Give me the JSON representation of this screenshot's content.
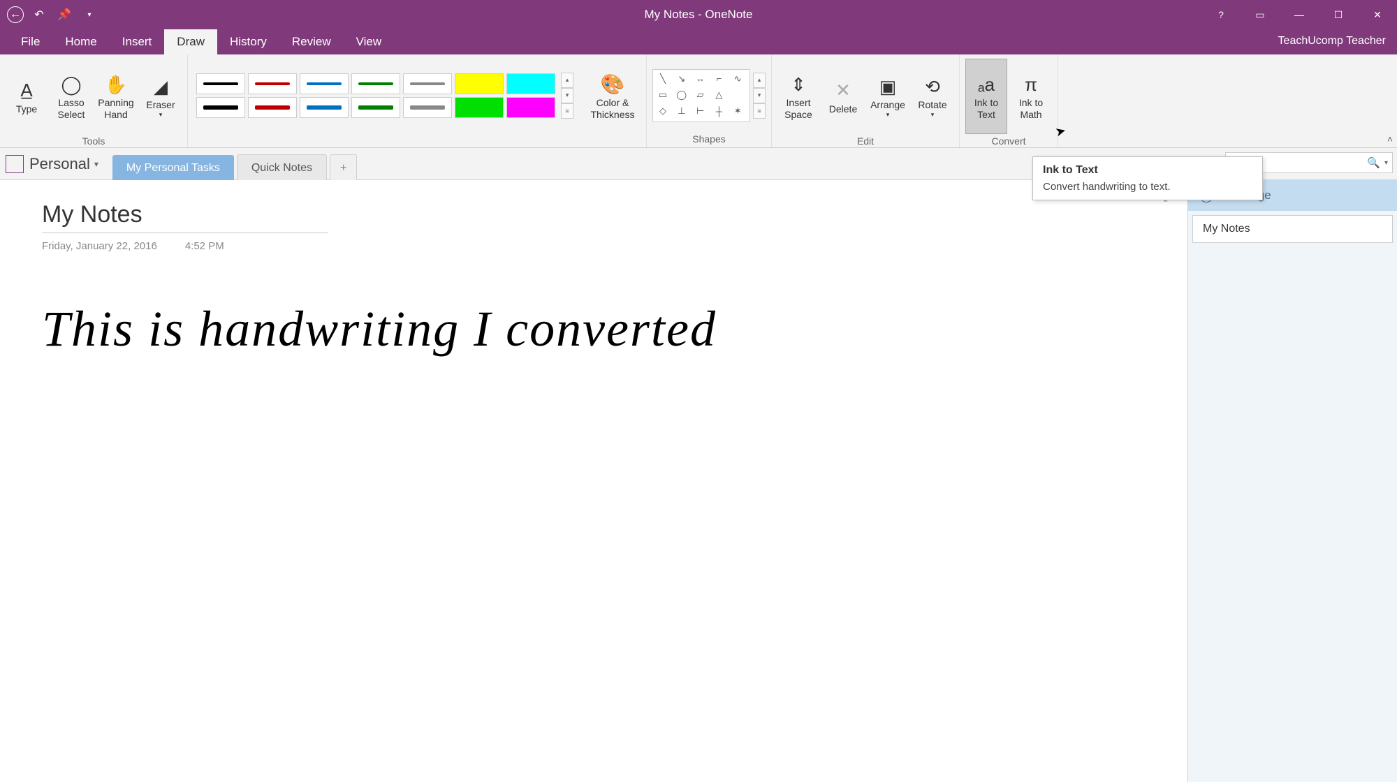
{
  "titlebar": {
    "title": "My Notes - OneNote",
    "help": "?"
  },
  "menu": {
    "file": "File",
    "home": "Home",
    "insert": "Insert",
    "draw": "Draw",
    "history": "History",
    "review": "Review",
    "view": "View",
    "teacher": "TeachUcomp Teacher"
  },
  "ribbon": {
    "type": "Type",
    "lasso": "Lasso Select",
    "panning": "Panning Hand",
    "eraser": "Eraser",
    "tools_label": "Tools",
    "color_thickness": "Color & Thickness",
    "shapes_label": "Shapes",
    "insert_space": "Insert Space",
    "delete": "Delete",
    "arrange": "Arrange",
    "rotate": "Rotate",
    "edit_label": "Edit",
    "ink_to_text": "Ink to Text",
    "ink_to_math": "Ink to Math",
    "convert_label": "Convert"
  },
  "notebook": {
    "name": "Personal",
    "tab1": "My Personal Tasks",
    "tab2": "Quick Notes",
    "add": "+"
  },
  "tooltip": {
    "title": "Ink to Text",
    "body": "Convert handwriting to text."
  },
  "page": {
    "title": "My Notes",
    "date": "Friday, January 22, 2016",
    "time": "4:52 PM",
    "handwriting": "This is handwriting I converted"
  },
  "pagelist": {
    "add": "Add Page",
    "item1": "My Notes"
  }
}
